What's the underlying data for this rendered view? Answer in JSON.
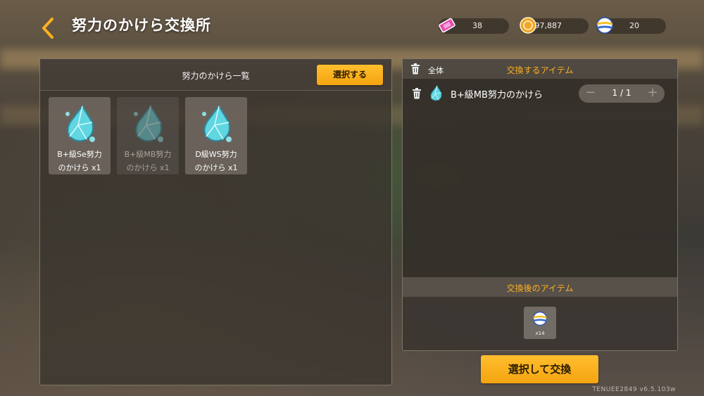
{
  "header": {
    "title": "努力のかけら交換所",
    "currencies": [
      {
        "icon": "ticket-icon",
        "value": "38",
        "color": "#e64ab0"
      },
      {
        "icon": "coin-icon",
        "value": "97,887",
        "color": "#f2a52a"
      },
      {
        "icon": "ball-icon",
        "value": "20",
        "color": "#3a6fd0"
      }
    ]
  },
  "left": {
    "title": "努力のかけら一覧",
    "select_label": "選択する",
    "items": [
      {
        "name": "B+級Se努力\nのかけら x1",
        "state": "normal"
      },
      {
        "name": "B+級MB努力\nのかけら x1",
        "state": "selected"
      },
      {
        "name": "D級WS努力\nのかけら x1",
        "state": "normal"
      }
    ]
  },
  "right": {
    "all_label": "全体",
    "exchange_items_title": "交換するアイテム",
    "rows": [
      {
        "name": "B+級MB努力のかけら",
        "qty": "1 / 1",
        "minus": "−",
        "plus": "+"
      }
    ],
    "after_title": "交換後のアイテム",
    "reward": {
      "count": "x14",
      "icon": "ball-icon"
    }
  },
  "exchange_label": "選択して交換",
  "version": "TENUEE2849  v6.5.103w",
  "colors": {
    "accent": "#ffb020",
    "button": "#f5a411"
  }
}
